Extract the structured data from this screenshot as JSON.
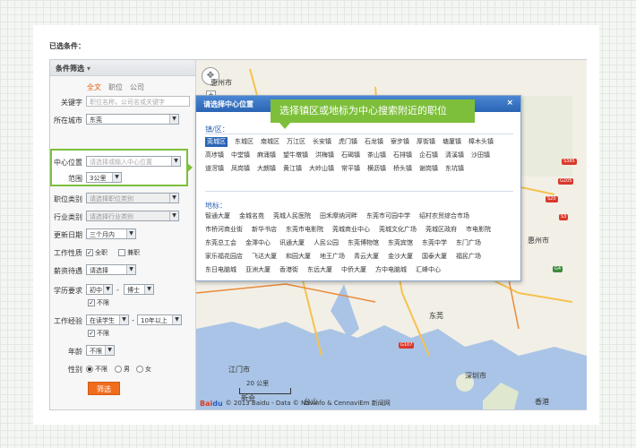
{
  "header": {
    "selected_conditions": "已选条件："
  },
  "sidebar": {
    "title": "条件筛选",
    "tabs": [
      "全文",
      "职位",
      "公司"
    ],
    "keyword": {
      "label": "关键字",
      "placeholder": "职位名称，公司名或关键字"
    },
    "city": {
      "label": "所在城市",
      "value": "东莞"
    },
    "center": {
      "label": "中心位置",
      "placeholder": "请选择或输入中心位置"
    },
    "range": {
      "label": "范围",
      "value": "3公里"
    },
    "category": {
      "label": "职位类别",
      "placeholder": "请选择职位类别"
    },
    "industry": {
      "label": "行业类别",
      "placeholder": "请选择行业类别"
    },
    "update": {
      "label": "更新日期",
      "value": "三个月内"
    },
    "job_type": {
      "label": "工作性质",
      "options": [
        "全职",
        "兼职"
      ]
    },
    "salary": {
      "label": "薪资待遇",
      "value": "请选择"
    },
    "education": {
      "label": "学历要求",
      "from": "初中",
      "sep": "-",
      "to": "博士",
      "unlimited": "不限"
    },
    "experience": {
      "label": "工作经验",
      "from": "在读学生",
      "sep": "-",
      "to": "10年以上",
      "unlimited": "不限"
    },
    "age": {
      "label": "年龄",
      "value": "不限"
    },
    "gender": {
      "label": "性别",
      "options": [
        "不限",
        "男",
        "女"
      ]
    },
    "search_button": "筛选"
  },
  "map": {
    "places": {
      "yixuanshi": "惠州市",
      "jiangmen": "江门市",
      "shenzhen": "深圳市",
      "huizhou": "惠州市",
      "dongguan": "东莞",
      "xinhui": "新会",
      "taishan": "台山",
      "xiangzhou": "香港"
    },
    "highways": [
      "S20",
      "G4",
      "S3",
      "G107",
      "G205",
      "S385"
    ],
    "scale_label": "20 公里",
    "copyright": "© 2013 Baidu - Data © NavInfo & CennaviEm 新闻网",
    "logo": {
      "a": "Bai",
      "b": "du"
    }
  },
  "dialog": {
    "title": "请选择中心位置",
    "close": "×",
    "callout": "选择镇区或地标为中心搜索附近的职位",
    "towns_title": "镇/区：",
    "towns": [
      "莞城区",
      "东城区",
      "南城区",
      "万江区",
      "长安镇",
      "虎门镇",
      "石龙镇",
      "寮步镇",
      "厚街镇",
      "塘厦镇",
      "樟木头镇",
      "高埗镇",
      "中堂镇",
      "麻涌镇",
      "望牛墩镇",
      "洪梅镇",
      "石碣镇",
      "茶山镇",
      "石排镇",
      "企石镇",
      "清溪镇",
      "沙田镇",
      "道滘镇",
      "凤岗镇",
      "大朗镇",
      "黄江镇",
      "大岭山镇",
      "常平镇",
      "横沥镇",
      "桥头镇",
      "谢岗镇",
      "东坑镇"
    ],
    "landmarks_title": "地标：",
    "landmarks": [
      "智通大厦",
      "金城名苑",
      "莞城人民医院",
      "田禾摩纳河畔",
      "东莞市可园中学",
      "绍村农贸综合市场",
      "市桥河商业街",
      "新华书店",
      "东莞市电影院",
      "莞城商业中心",
      "莞城文化广场",
      "莞城区政府",
      "市电影院",
      "东莞总工会",
      "金澤中心",
      "讯通大厦",
      "人民公园",
      "东莞博物馆",
      "东莞宾馆",
      "东莞中学",
      "东门广场",
      "家乐福花园店",
      "飞达大厦",
      "和园大厦",
      "地王广场",
      "青云大厦",
      "金沙大厦",
      "国泰大厦",
      "福民广场",
      "东日电脑城",
      "亚洲大厦",
      "香港街",
      "东远大厦",
      "中侨大厦",
      "方中电脑城",
      "汇峰中心"
    ]
  },
  "colors": {
    "accent_green": "#7dbf3a",
    "accent_orange": "#f06d1e",
    "title_blue": "#2a64b4"
  }
}
